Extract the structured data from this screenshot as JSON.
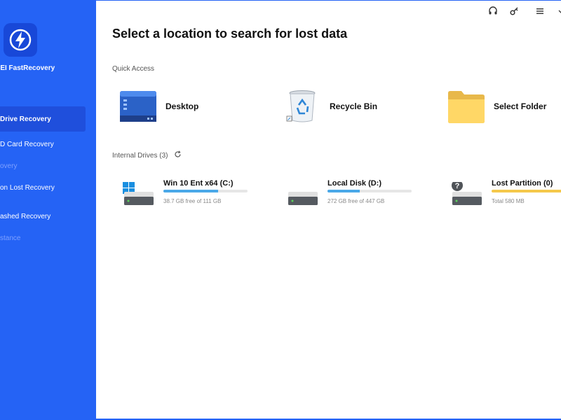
{
  "app": {
    "name": "MEI FastRecovery"
  },
  "sidebar": {
    "section_label": "",
    "items": [
      {
        "label": "Drive Recovery"
      },
      {
        "label": "D Card Recovery"
      },
      {
        "label": "overy"
      },
      {
        "label": "on Lost Recovery"
      },
      {
        "label": "ashed Recovery"
      },
      {
        "label": "stance"
      }
    ]
  },
  "topbar": {
    "icons": [
      "headset-icon",
      "key-icon",
      "menu-icon",
      "chevron-icon"
    ]
  },
  "main": {
    "title": "Select a location to search for lost data",
    "quick_access_label": "Quick Access",
    "quick_access": [
      {
        "label": "Desktop",
        "icon": "desktop-icon"
      },
      {
        "label": "Recycle Bin",
        "icon": "recycle-bin-icon"
      },
      {
        "label": "Select Folder",
        "icon": "folder-icon"
      }
    ],
    "internal_drives_label": "Internal Drives (3)",
    "drives": [
      {
        "name": "Win 10 Ent x64 (C:)",
        "size_text": "38.7 GB free of 111 GB",
        "used_fraction": 0.65,
        "bar_color": "#4aa8e8"
      },
      {
        "name": "Local Disk (D:)",
        "size_text": "272 GB free of 447 GB",
        "used_fraction": 0.38,
        "bar_color": "#4aa8e8"
      },
      {
        "name": "Lost Partition (0)",
        "size_text": "Total 580 MB",
        "used_fraction": 1.0,
        "bar_color": "#f5c84b"
      }
    ]
  },
  "colors": {
    "accent": "#2563f5",
    "sidebar_active": "#1f4fdc"
  }
}
